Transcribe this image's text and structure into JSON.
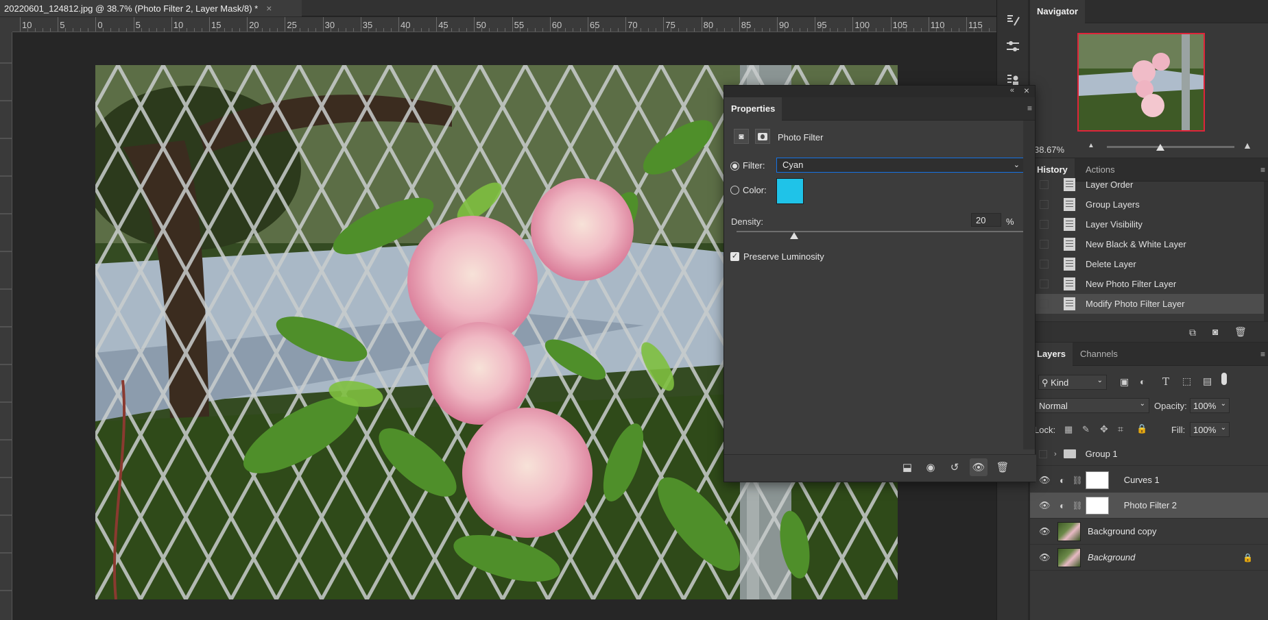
{
  "document": {
    "tab_title": "20220601_124812.jpg @ 38.7% (Photo Filter 2, Layer Mask/8) *",
    "close_glyph": "×"
  },
  "ruler": {
    "labels": [
      "10",
      "5",
      "0",
      "5",
      "10",
      "15",
      "20",
      "25",
      "30",
      "35",
      "40",
      "45",
      "50",
      "55",
      "60",
      "65",
      "70",
      "75",
      "80",
      "85",
      "90",
      "95",
      "100",
      "105",
      "110",
      "115"
    ]
  },
  "navigator": {
    "tab": "Navigator",
    "zoom": "38.67%"
  },
  "history": {
    "tabs": [
      "History",
      "Actions"
    ],
    "items": [
      {
        "label": "Layer Order",
        "active": false
      },
      {
        "label": "Group Layers",
        "active": false
      },
      {
        "label": "Layer Visibility",
        "active": false
      },
      {
        "label": "New Black & White Layer",
        "active": false
      },
      {
        "label": "Delete Layer",
        "active": false
      },
      {
        "label": "New Photo Filter Layer",
        "active": false
      },
      {
        "label": "Modify Photo Filter Layer",
        "active": true
      }
    ]
  },
  "layers": {
    "tabs": [
      "Layers",
      "Channels"
    ],
    "kind_label": "Kind",
    "blend_mode": "Normal",
    "opacity_label": "Opacity:",
    "opacity_value": "100%",
    "lock_label": "Lock:",
    "fill_label": "Fill:",
    "fill_value": "100%",
    "items": [
      {
        "name": "Group 1",
        "type": "group",
        "visible": false,
        "selected": false
      },
      {
        "name": "Curves 1",
        "type": "adjustment",
        "visible": true,
        "selected": false
      },
      {
        "name": "Photo Filter 2",
        "type": "adjustment",
        "visible": true,
        "selected": true
      },
      {
        "name": "Background copy",
        "type": "pixel",
        "visible": true,
        "selected": false
      },
      {
        "name": "Background",
        "type": "pixel",
        "visible": true,
        "selected": false,
        "locked": true
      }
    ]
  },
  "properties": {
    "tab": "Properties",
    "adjustment_name": "Photo Filter",
    "filter_label": "Filter:",
    "filter_value": "Cyan",
    "color_label": "Color:",
    "color_swatch": "#1fc3e8",
    "density_label": "Density:",
    "density_value": "20",
    "density_unit": "%",
    "density_level": 20,
    "preserve_label": "Preserve Luminosity",
    "preserve_checked": true
  },
  "colors": {
    "accent": "#1473e6",
    "nav_frame": "#e0243a"
  }
}
